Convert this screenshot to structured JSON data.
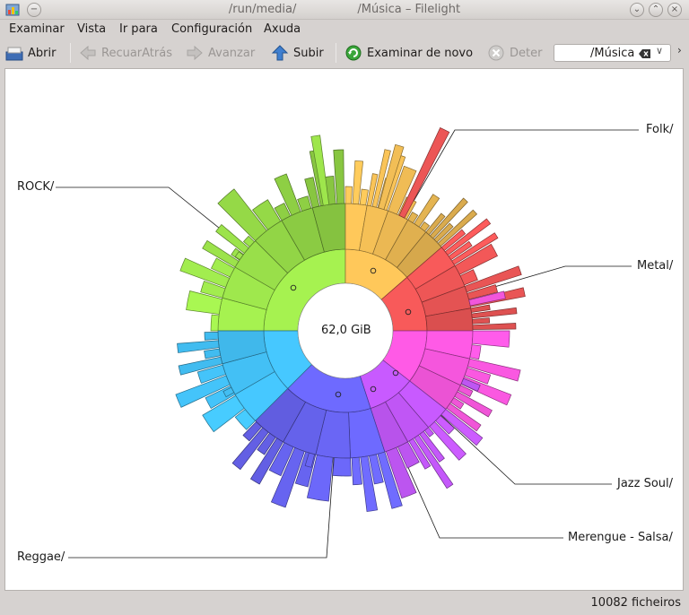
{
  "window": {
    "title_part1": "/run/media/",
    "title_part2": "/Música – Filelight"
  },
  "menu": [
    "Examinar",
    "Vista",
    "Ir para",
    "Configuración",
    "Axuda"
  ],
  "toolbar": {
    "open": "Abrir",
    "back": "RecuarAtrás",
    "forward": "Avanzar",
    "up": "Subir",
    "rescan": "Examinar de novo",
    "stop": "Deter"
  },
  "location": {
    "value": "/Música"
  },
  "map": {
    "center_label": "62,0 GiB",
    "labels": {
      "folk": "Folk/",
      "rock": "ROCK/",
      "metal": "Metal/",
      "jazz": "Jazz Soul/",
      "merengue": "Merengue - Salsa/",
      "reggae": "Reggae/"
    }
  },
  "status": {
    "files": "10082 ficheiros"
  },
  "colors": {
    "rock": "#a6f250",
    "folk": "#ffc85a",
    "metal": "#f85a5a",
    "jazz": "#ff5ae6",
    "merengue": "#c85aff",
    "reggae": "#6e6aff",
    "blue": "#46c8ff"
  }
}
